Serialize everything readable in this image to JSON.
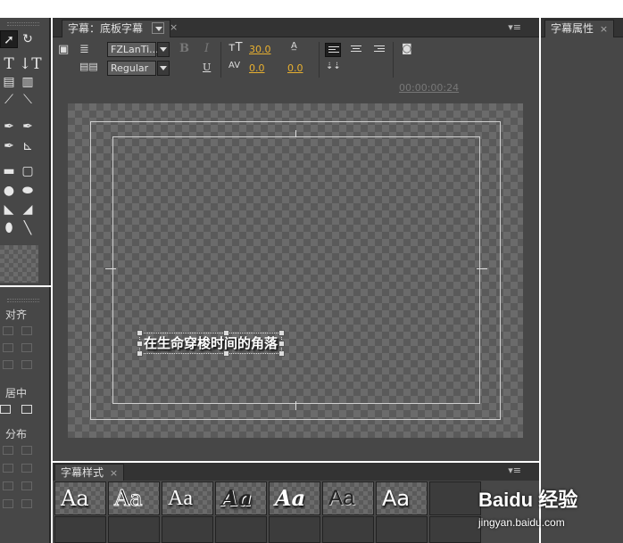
{
  "main_panel": {
    "tab_title": "字幕：底板字幕",
    "toolbar": {
      "font_family": "FZLanTi...",
      "font_style": "Regular",
      "bold_label": "B",
      "italic_label": "I",
      "underline_label": "U",
      "font_size": "30.0",
      "kerning": "0.0",
      "leading": "0.0",
      "tracking": "0.0",
      "timecode": "00:00:00:24"
    },
    "caption_text": "在生命穿梭时间的角落"
  },
  "left_panel": {
    "align_label": "对齐",
    "center_label": "居中",
    "distribute_label": "分布"
  },
  "right_panel": {
    "tab_title": "字幕属性"
  },
  "styles_panel": {
    "tab_title": "字幕样式",
    "swatches": [
      "Aa",
      "Aa",
      "Aa",
      "Aa",
      "Aa",
      "Aa",
      "Aa"
    ]
  },
  "watermark": {
    "logo": "Baidu 经验",
    "url": "jingyan.baidu.com"
  }
}
